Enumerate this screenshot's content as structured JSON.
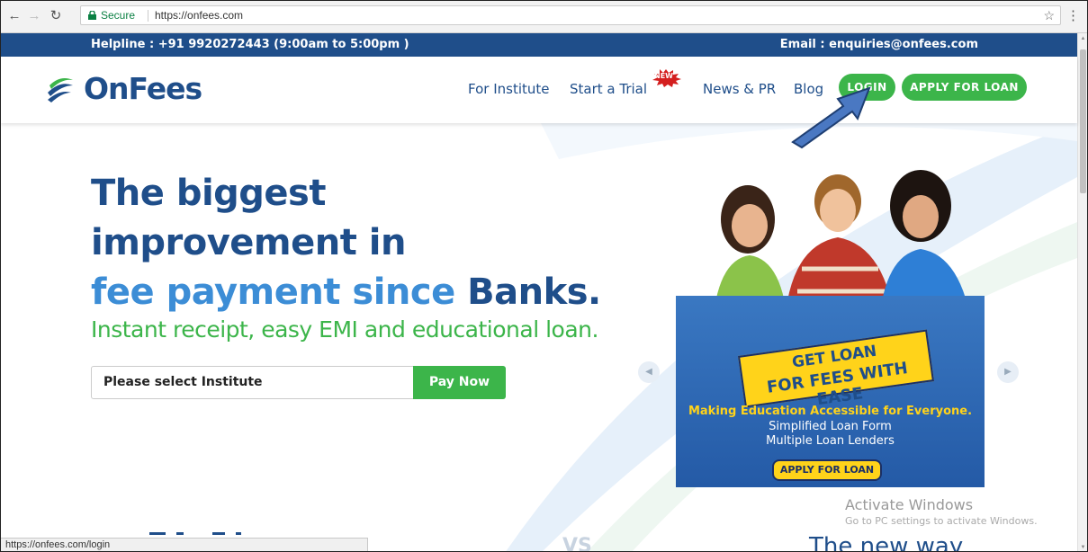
{
  "browser": {
    "secure_label": "Secure",
    "url": "https://onfees.com",
    "status_url": "https://onfees.com/login"
  },
  "infobar": {
    "helpline": "Helpline : +91 9920272443 (9:00am to 5:00pm )",
    "email": "Email : enquiries@onfees.com"
  },
  "header": {
    "logo_text": "OnFees",
    "nav": {
      "for_institute": "For Institute",
      "start_trial": "Start a Trial",
      "new_badge": "NEW",
      "news_pr": "News & PR",
      "blog": "Blog"
    },
    "login_label": "LOGIN",
    "apply_label": "APPLY FOR LOAN"
  },
  "hero": {
    "headline_line1": "The biggest",
    "headline_line2": "improvement in",
    "headline_line3_prefix": "fee payment since ",
    "headline_line3_bold": "Banks.",
    "subline": "Instant receipt, easy EMI and educational loan.",
    "select_placeholder": "Please select Institute",
    "pay_now_label": "Pay Now"
  },
  "banner": {
    "sign_line1": "GET LOAN",
    "sign_line2": "FOR FEES WITH EASE",
    "tagline": "Making Education Accessible for Everyone.",
    "point1": "Simplified Loan Form",
    "point2": "Multiple Loan Lenders",
    "apply_label": "APPLY FOR LOAN"
  },
  "overlay": {
    "activate_title": "Activate Windows",
    "activate_sub": "Go to PC settings to activate Windows."
  },
  "below_fold": {
    "vs": "VS",
    "new_way": "The new way"
  },
  "colors": {
    "brand_blue": "#1f4e8a",
    "brand_green": "#3cb54a",
    "banner_yellow": "#ffd31a"
  }
}
